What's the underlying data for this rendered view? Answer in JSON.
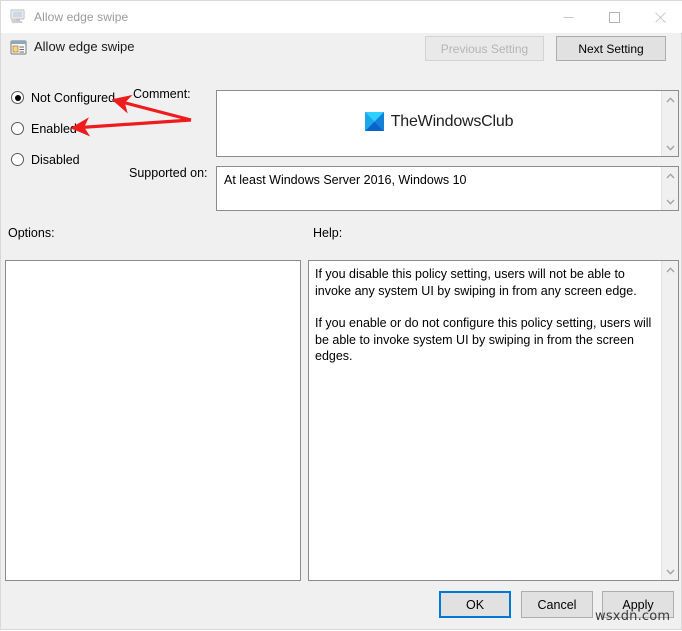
{
  "window": {
    "title": "Allow edge swipe",
    "title_icon": "computer-policy-icon",
    "controls": {
      "minimize": "minimize-icon",
      "maximize": "maximize-icon",
      "close": "close-icon"
    }
  },
  "header": {
    "icon": "policy-setting-icon",
    "title": "Allow edge swipe",
    "previous_setting": "Previous Setting",
    "next_setting": "Next Setting"
  },
  "state": {
    "options": [
      {
        "label": "Not Configured",
        "selected": true
      },
      {
        "label": "Enabled",
        "selected": false
      },
      {
        "label": "Disabled",
        "selected": false
      }
    ]
  },
  "fields": {
    "comment_label": "Comment:",
    "comment_value": "",
    "supported_label": "Supported on:",
    "supported_value": "At least Windows Server 2016, Windows 10",
    "options_label": "Options:",
    "help_label": "Help:"
  },
  "comment_watermark": {
    "logo": "thewindowsclub-logo-icon",
    "text": "TheWindowsClub"
  },
  "help": {
    "paragraphs": [
      "If you disable this policy setting, users will not be able to invoke any system UI by swiping in from any screen edge.",
      "If you enable or do not configure this policy setting, users will be able to invoke system UI by swiping in from the screen edges."
    ]
  },
  "footer": {
    "ok": "OK",
    "cancel": "Cancel",
    "apply": "Apply"
  },
  "site_watermark": "wsxdn.com",
  "colors": {
    "accent": "#0078d7",
    "annotation": "#ee1c1c",
    "window_bg": "#f0f0f0",
    "logo_cyan": "#23c0f5",
    "logo_blue": "#0a64c8"
  }
}
